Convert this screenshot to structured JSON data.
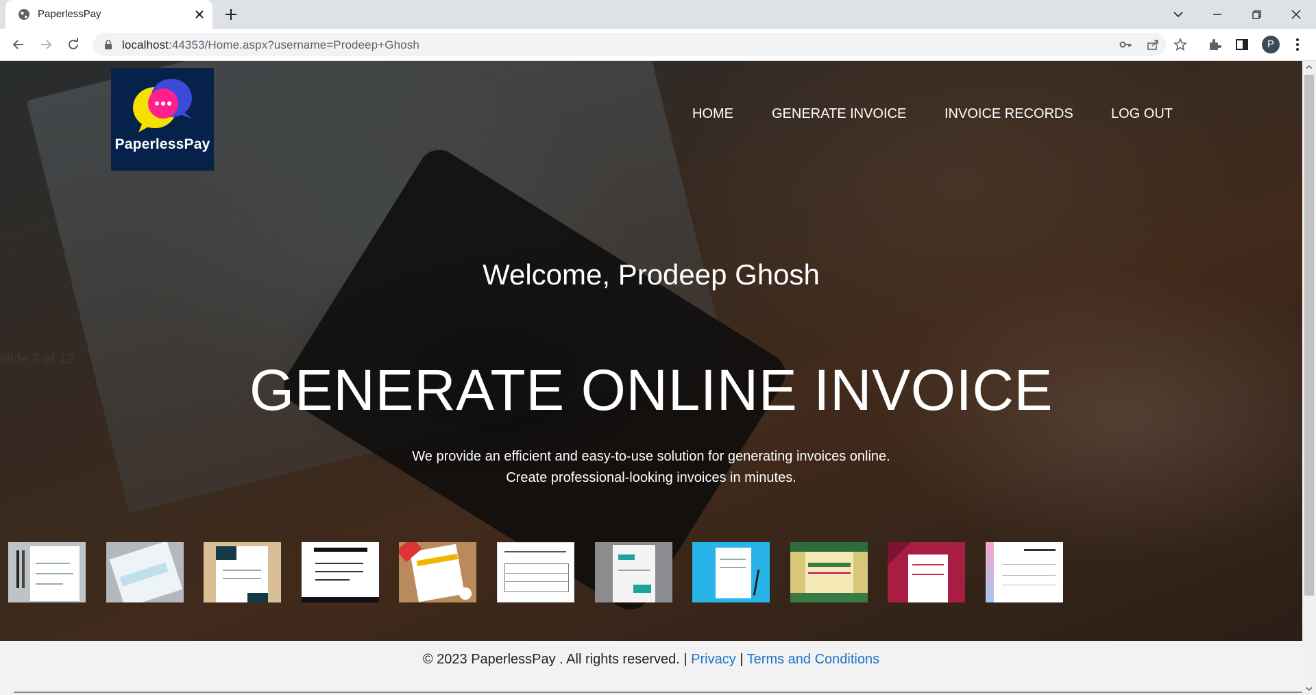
{
  "browser": {
    "tab_title": "PaperlessPay",
    "url_prefix": "localhost",
    "url_port": ":44353",
    "url_path": "/Home.aspx?username=Prodeep+Ghosh",
    "profile_initial": "P"
  },
  "site": {
    "logo_text": "PaperlessPay",
    "nav": {
      "home": "HOME",
      "generate": "GENERATE INVOICE",
      "records": "INVOICE RECORDS",
      "logout": "LOG OUT"
    },
    "welcome": "Welcome, Prodeep Ghosh",
    "slide_label": "slide 3 of 12",
    "headline": "GENERATE ONLINE INVOICE",
    "subline_1": "We provide an efficient and easy-to-use solution for generating invoices online.",
    "subline_2": "Create professional-looking invoices in minutes.",
    "footer": {
      "copyright": "© 2023 PaperlessPay . All rights reserved. |",
      "privacy": "Privacy",
      "separator": "|",
      "terms": "Terms and Conditions"
    }
  },
  "colors": {
    "logo_bg": "#06224a",
    "link": "#1a73c8"
  }
}
